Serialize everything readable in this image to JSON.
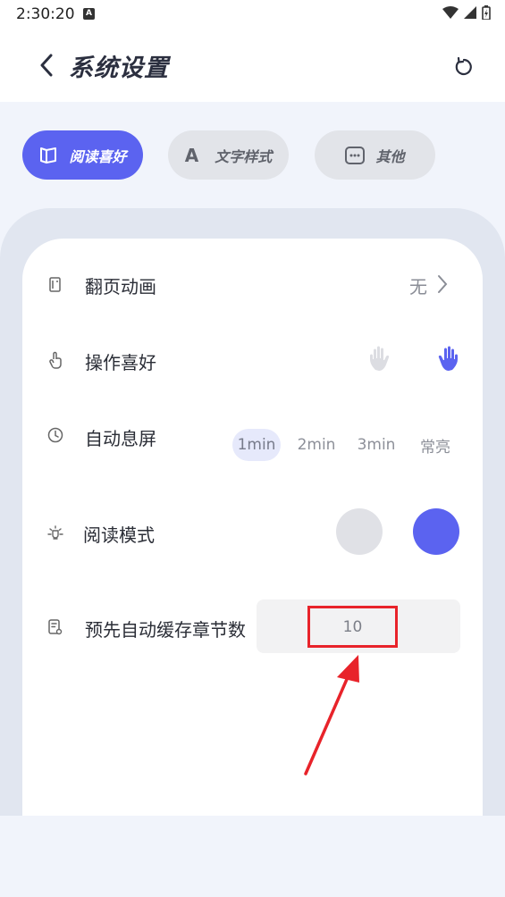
{
  "status_bar": {
    "time": "2:30:20",
    "notif_glyph": "A"
  },
  "header": {
    "title": "系统设置",
    "back_icon": "back-chevron-icon",
    "reset_icon": "reset-icon"
  },
  "tabs": [
    {
      "label": "阅读喜好",
      "icon": "book-icon",
      "active": true
    },
    {
      "label": "文字样式",
      "icon": "letter-a-icon",
      "active": false
    },
    {
      "label": "其他",
      "icon": "more-dots-icon",
      "active": false
    }
  ],
  "settings": {
    "page_turn": {
      "label": "翻页动画",
      "value": "无"
    },
    "operation": {
      "label": "操作喜好"
    },
    "screen_off": {
      "label": "自动息屏",
      "options": [
        "1min",
        "2min",
        "3min",
        "常亮"
      ],
      "selected": "1min"
    },
    "reading_mode": {
      "label": "阅读模式"
    },
    "precache": {
      "label": "预先自动缓存章节数",
      "value": "10"
    }
  },
  "colors": {
    "accent": "#5b63f0",
    "highlight": "#e8232a",
    "light_circle": "#e0e1e6"
  }
}
